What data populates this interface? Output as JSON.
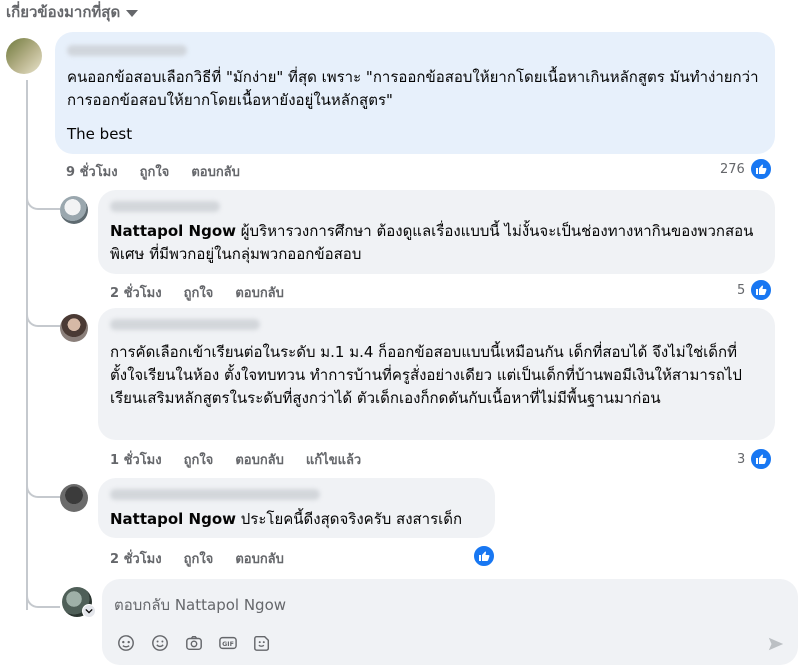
{
  "sort_label": "เกี่ยวข้องมากที่สุด",
  "comments": [
    {
      "text": "คนออกข้อสอบเลือกวิธีที่ \"มักง่าย\" ที่สุด เพราะ \"การออกข้อสอบให้ยากโดยเนื้อหาเกินหลักสูตร มันทำง่ายกว่า การออกข้อสอบให้ยากโดยเนื้อหายังอยู่ในหลักสูตร\"",
      "text2": "The best",
      "time": "9 ชั่วโมง",
      "like": "ถูกใจ",
      "reply": "ตอบกลับ",
      "likes": "276"
    },
    {
      "mention": "Nattapol Ngow",
      "text": " ผู้บริหารวงการศึกษา ต้องดูแลเรื่องแบบนี้ ไม่งั้นจะเป็นช่องทางหากินของพวกสอนพิเศษ ที่มีพวกอยู่ในกลุ่มพวกออกข้อสอบ",
      "time": "2 ชั่วโมง",
      "like": "ถูกใจ",
      "reply": "ตอบกลับ",
      "likes": "5"
    },
    {
      "text": "การคัดเลือกเข้าเรียนต่อในระดับ ม.1 ม.4 ก็ออกข้อสอบแบบนี้เหมือนกัน เด็กที่สอบได้ จึงไม่ใช่เด็กที่ตั้งใจเรียนในห้อง ตั้งใจทบทวน ทำการบ้านที่ครูสั่งอย่างเดียว แต่เป็นเด็กที่บ้านพอมีเงินให้สามารถไปเรียนเสริมหลักสูตรในระดับที่สูงกว่าได้ ตัวเด็กเองก็กดดันกับเนื้อหาที่ไม่มีพื้นฐานมาก่อน",
      "time": "1 ชั่วโมง",
      "like": "ถูกใจ",
      "reply": "ตอบกลับ",
      "edited": "แก้ไขแล้ว",
      "likes": "3"
    },
    {
      "mention": "Nattapol Ngow",
      "text": " ประโยคนี้ดีงสุดจริงครับ สงสารเด็ก",
      "time": "2 ชั่วโมง",
      "like": "ถูกใจ",
      "reply": "ตอบกลับ"
    }
  ],
  "reply_box": {
    "placeholder": "ตอบกลับ Nattapol Ngow"
  },
  "icons": [
    "sticker-icon",
    "emoji-icon",
    "camera-icon",
    "gif-icon",
    "avatar-sticker-icon",
    "send-icon",
    "like-icon",
    "chevron-down-icon"
  ],
  "colors": {
    "accent": "#1877f2",
    "bubble": "#f0f2f5",
    "highlight_bubble": "#e7f0fb",
    "muted": "#65676b"
  }
}
